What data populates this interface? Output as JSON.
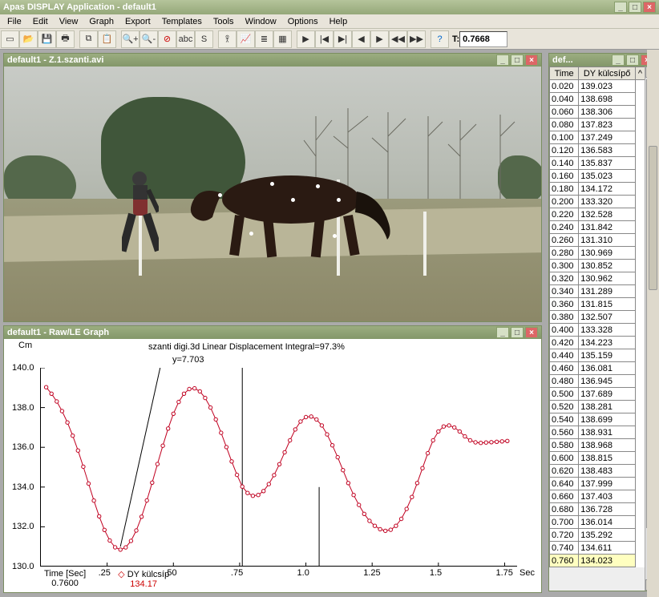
{
  "app": {
    "title": "Apas DISPLAY Application - default1"
  },
  "menu": [
    "File",
    "Edit",
    "View",
    "Graph",
    "Export",
    "Templates",
    "Tools",
    "Window",
    "Options",
    "Help"
  ],
  "toolbar_t_label": "T:",
  "toolbar_t_value": "0.7668",
  "video_win": {
    "title": "default1 - Z.1.szanti.avi"
  },
  "graph_win": {
    "title": "default1 - Raw/LE Graph",
    "chart_title": "szanti digi.3d Linear Displacement   Integral=97.3%",
    "y_unit": "Cm",
    "x_unit": "Sec",
    "annotation": "y=7.703",
    "legend_time_label": "Time [Sec]",
    "legend_time_value": "0.7600",
    "legend_series_label": "DY külcsíp",
    "legend_series_value": "134.17"
  },
  "data_win": {
    "title": "def...",
    "col_time": "Time",
    "col_val": "DY külcsípő"
  },
  "chart_data": {
    "type": "line",
    "title": "szanti digi.3d Linear Displacement   Integral=97.3%",
    "xlabel": "Sec",
    "ylabel": "Cm",
    "xlim": [
      0.0,
      1.8
    ],
    "ylim": [
      130.0,
      140.0
    ],
    "xticks": [
      0.25,
      0.5,
      0.75,
      1.0,
      1.25,
      1.5,
      1.75
    ],
    "yticks": [
      130.0,
      132.0,
      134.0,
      136.0,
      138.0,
      140.0
    ],
    "cursor_x": 0.76,
    "cursor_y": 134.17,
    "aux_vline_x": 1.05,
    "annotation": {
      "text": "y=7.703",
      "x": 0.45,
      "y": 140.0,
      "line_to_x": 0.3,
      "line_to_y": 131.0
    },
    "series": [
      {
        "name": "DY külcsíp",
        "color": "#c00020",
        "x": [
          0.02,
          0.04,
          0.06,
          0.08,
          0.1,
          0.12,
          0.14,
          0.16,
          0.18,
          0.2,
          0.22,
          0.24,
          0.26,
          0.28,
          0.3,
          0.32,
          0.34,
          0.36,
          0.38,
          0.4,
          0.42,
          0.44,
          0.46,
          0.48,
          0.5,
          0.52,
          0.54,
          0.56,
          0.58,
          0.6,
          0.62,
          0.64,
          0.66,
          0.68,
          0.7,
          0.72,
          0.74,
          0.76,
          0.78,
          0.8,
          0.82,
          0.84,
          0.86,
          0.88,
          0.9,
          0.92,
          0.94,
          0.96,
          0.98,
          1.0,
          1.02,
          1.04,
          1.06,
          1.08,
          1.1,
          1.12,
          1.14,
          1.16,
          1.18,
          1.2,
          1.22,
          1.24,
          1.26,
          1.28,
          1.3,
          1.32,
          1.34,
          1.36,
          1.38,
          1.4,
          1.42,
          1.44,
          1.46,
          1.48,
          1.5,
          1.52,
          1.54,
          1.56,
          1.58,
          1.6,
          1.62,
          1.64,
          1.66,
          1.68,
          1.7,
          1.72,
          1.74,
          1.76
        ],
        "y": [
          139.023,
          138.698,
          138.306,
          137.823,
          137.249,
          136.583,
          135.837,
          135.023,
          134.172,
          133.32,
          132.528,
          131.842,
          131.31,
          130.969,
          130.852,
          130.962,
          131.289,
          131.815,
          132.507,
          133.328,
          134.223,
          135.159,
          136.081,
          136.945,
          137.689,
          138.281,
          138.699,
          138.931,
          138.968,
          138.815,
          138.483,
          137.999,
          137.403,
          136.728,
          136.014,
          135.292,
          134.611,
          134.023,
          133.7,
          133.56,
          133.6,
          133.8,
          134.15,
          134.6,
          135.15,
          135.75,
          136.35,
          136.9,
          137.3,
          137.52,
          137.55,
          137.4,
          137.1,
          136.65,
          136.1,
          135.5,
          134.85,
          134.2,
          133.6,
          133.1,
          132.65,
          132.3,
          132.05,
          131.88,
          131.8,
          131.85,
          132.05,
          132.4,
          132.9,
          133.5,
          134.2,
          134.95,
          135.7,
          136.35,
          136.8,
          137.05,
          137.1,
          137.0,
          136.8,
          136.55,
          136.35,
          136.25,
          136.22,
          136.24,
          136.26,
          136.28,
          136.3,
          136.32
        ]
      }
    ]
  },
  "table_rows": [
    {
      "t": "0.020",
      "v": "139.023"
    },
    {
      "t": "0.040",
      "v": "138.698"
    },
    {
      "t": "0.060",
      "v": "138.306"
    },
    {
      "t": "0.080",
      "v": "137.823"
    },
    {
      "t": "0.100",
      "v": "137.249"
    },
    {
      "t": "0.120",
      "v": "136.583"
    },
    {
      "t": "0.140",
      "v": "135.837"
    },
    {
      "t": "0.160",
      "v": "135.023"
    },
    {
      "t": "0.180",
      "v": "134.172"
    },
    {
      "t": "0.200",
      "v": "133.320"
    },
    {
      "t": "0.220",
      "v": "132.528"
    },
    {
      "t": "0.240",
      "v": "131.842"
    },
    {
      "t": "0.260",
      "v": "131.310"
    },
    {
      "t": "0.280",
      "v": "130.969"
    },
    {
      "t": "0.300",
      "v": "130.852"
    },
    {
      "t": "0.320",
      "v": "130.962"
    },
    {
      "t": "0.340",
      "v": "131.289"
    },
    {
      "t": "0.360",
      "v": "131.815"
    },
    {
      "t": "0.380",
      "v": "132.507"
    },
    {
      "t": "0.400",
      "v": "133.328"
    },
    {
      "t": "0.420",
      "v": "134.223"
    },
    {
      "t": "0.440",
      "v": "135.159"
    },
    {
      "t": "0.460",
      "v": "136.081"
    },
    {
      "t": "0.480",
      "v": "136.945"
    },
    {
      "t": "0.500",
      "v": "137.689"
    },
    {
      "t": "0.520",
      "v": "138.281"
    },
    {
      "t": "0.540",
      "v": "138.699"
    },
    {
      "t": "0.560",
      "v": "138.931"
    },
    {
      "t": "0.580",
      "v": "138.968"
    },
    {
      "t": "0.600",
      "v": "138.815"
    },
    {
      "t": "0.620",
      "v": "138.483"
    },
    {
      "t": "0.640",
      "v": "137.999"
    },
    {
      "t": "0.660",
      "v": "137.403"
    },
    {
      "t": "0.680",
      "v": "136.728"
    },
    {
      "t": "0.700",
      "v": "136.014"
    },
    {
      "t": "0.720",
      "v": "135.292"
    },
    {
      "t": "0.740",
      "v": "134.611"
    },
    {
      "t": "0.760",
      "v": "134.023"
    }
  ],
  "table_highlight_index": 37
}
